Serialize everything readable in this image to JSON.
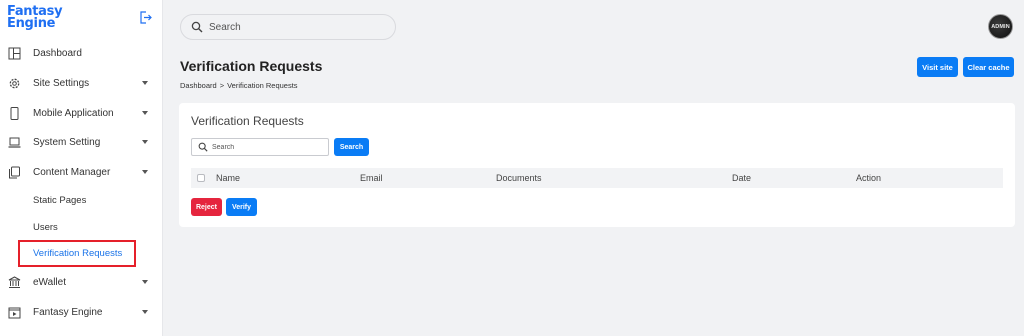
{
  "brand": {
    "line1": "Fantasy",
    "line2": "Engine"
  },
  "sidebar": {
    "items": [
      {
        "label": "Dashboard",
        "icon": "dashboard-icon",
        "has_caret": false
      },
      {
        "label": "Site Settings",
        "icon": "gear-icon",
        "has_caret": true
      },
      {
        "label": "Mobile Application",
        "icon": "mobile-icon",
        "has_caret": true
      },
      {
        "label": "System Setting",
        "icon": "laptop-icon",
        "has_caret": true
      },
      {
        "label": "Content Manager",
        "icon": "copy-icon",
        "has_caret": true
      },
      {
        "label": "eWallet",
        "icon": "bank-icon",
        "has_caret": true
      },
      {
        "label": "Fantasy Engine",
        "icon": "play-box-icon",
        "has_caret": true
      }
    ],
    "subitems": [
      {
        "label": "Static Pages",
        "active": false
      },
      {
        "label": "Users",
        "active": false
      },
      {
        "label": "Verification Requests",
        "active": true
      }
    ]
  },
  "topbar": {
    "search_placeholder": "Search",
    "avatar_text": "ADMIN"
  },
  "header": {
    "title": "Verification Requests",
    "breadcrumb": [
      "Dashboard",
      "Verification Requests"
    ],
    "breadcrumb_sep": ">",
    "visit_site": "Visit site",
    "clear_cache": "Clear cache"
  },
  "card": {
    "title": "Verification Requests",
    "search_placeholder": "Search",
    "search_button": "Search",
    "columns": [
      "Name",
      "Email",
      "Documents",
      "Date",
      "Action"
    ],
    "reject_label": "Reject",
    "verify_label": "Verify"
  },
  "colors": {
    "primary": "#0a7cf5",
    "danger": "#e5253e",
    "brand": "#1f6ff2",
    "highlight": "#e5202a"
  }
}
